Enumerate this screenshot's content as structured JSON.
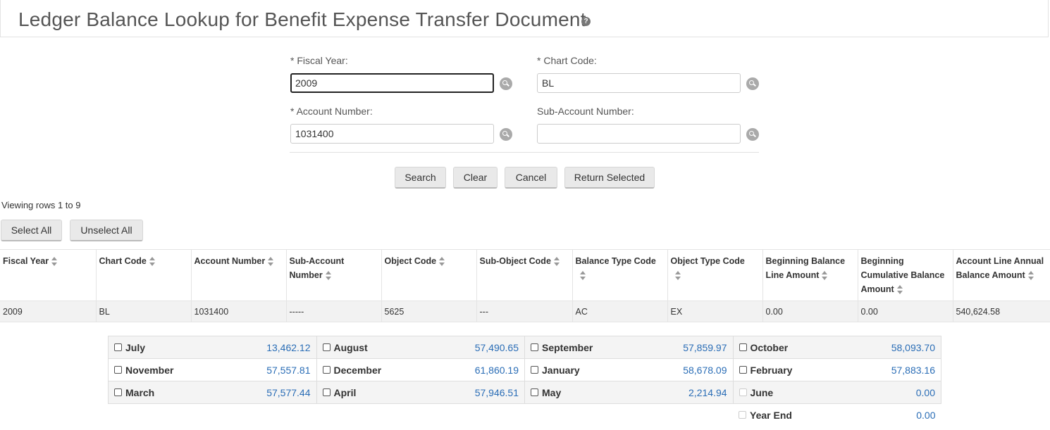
{
  "page": {
    "title": "Ledger Balance Lookup for Benefit Expense Transfer Document",
    "help": "?"
  },
  "form": {
    "fiscal_year": {
      "label": "*  Fiscal Year:",
      "value": "2009"
    },
    "chart_code": {
      "label": "*  Chart Code:",
      "value": "BL"
    },
    "account_number": {
      "label": "*  Account Number:",
      "value": "1031400"
    },
    "sub_account_number": {
      "label": "Sub-Account Number:",
      "value": ""
    }
  },
  "buttons": {
    "search": "Search",
    "clear": "Clear",
    "cancel": "Cancel",
    "return_selected": "Return Selected",
    "select_all": "Select All",
    "unselect_all": "Unselect All"
  },
  "results": {
    "viewing": "Viewing rows 1 to 9",
    "columns": [
      {
        "label": "Fiscal Year"
      },
      {
        "label": "Chart Code"
      },
      {
        "label": "Account Number"
      },
      {
        "label": "Sub-Account Number"
      },
      {
        "label": "Object Code"
      },
      {
        "label": "Sub-Object Code"
      },
      {
        "label": "Balance Type Code"
      },
      {
        "label": "Object Type Code"
      },
      {
        "label": "Beginning Balance Line Amount"
      },
      {
        "label": "Beginning Cumulative Balance Amount"
      },
      {
        "label": "Account Line Annual Balance Amount"
      }
    ],
    "row": [
      "2009",
      "BL",
      "1031400",
      "-----",
      "5625",
      "---",
      "AC",
      "EX",
      "0.00",
      "0.00",
      "540,624.58"
    ]
  },
  "months": [
    {
      "name": "July",
      "value": "13,462.12"
    },
    {
      "name": "August",
      "value": "57,490.65"
    },
    {
      "name": "September",
      "value": "57,859.97"
    },
    {
      "name": "October",
      "value": "58,093.70"
    },
    {
      "name": "November",
      "value": "57,557.81"
    },
    {
      "name": "December",
      "value": "61,860.19"
    },
    {
      "name": "January",
      "value": "58,678.09"
    },
    {
      "name": "February",
      "value": "57,883.16"
    },
    {
      "name": "March",
      "value": "57,577.44"
    },
    {
      "name": "April",
      "value": "57,946.51"
    },
    {
      "name": "May",
      "value": "2,214.94"
    },
    {
      "name": "June",
      "value": "0.00"
    },
    {
      "name": "Year End",
      "value": "0.00"
    }
  ]
}
